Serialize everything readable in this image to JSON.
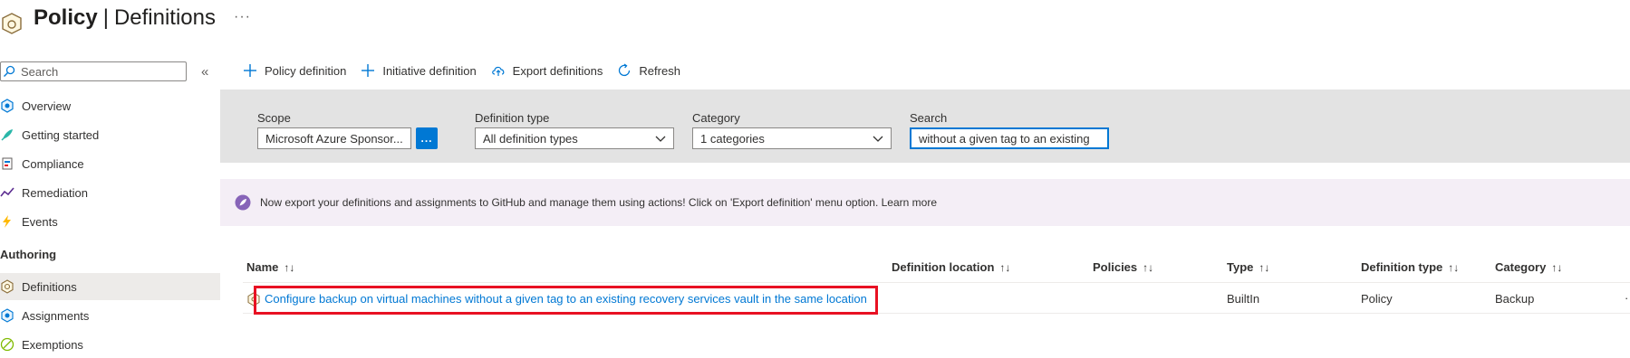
{
  "header": {
    "title_bold": "Policy",
    "title_sep": "|",
    "title_rest": "Definitions",
    "more": "···",
    "icon": "policy-icon"
  },
  "sidebar": {
    "search_placeholder": "Search",
    "collapse": "«",
    "items": [
      {
        "label": "Overview",
        "icon": "overview-icon"
      },
      {
        "label": "Getting started",
        "icon": "rocket-icon"
      },
      {
        "label": "Compliance",
        "icon": "compliance-icon"
      },
      {
        "label": "Remediation",
        "icon": "remediation-icon"
      },
      {
        "label": "Events",
        "icon": "lightning-icon"
      }
    ],
    "section": "Authoring",
    "authoring_items": [
      {
        "label": "Definitions",
        "icon": "definitions-icon",
        "active": true
      },
      {
        "label": "Assignments",
        "icon": "assignments-icon"
      },
      {
        "label": "Exemptions",
        "icon": "exemptions-icon"
      }
    ]
  },
  "toolbar": {
    "policy_definition": "Policy definition",
    "initiative_definition": "Initiative definition",
    "export_definitions": "Export definitions",
    "refresh": "Refresh"
  },
  "filters": {
    "scope_label": "Scope",
    "scope_value": "Microsoft Azure Sponsor...",
    "scope_button": "...",
    "definition_type_label": "Definition type",
    "definition_type_value": "All definition types",
    "category_label": "Category",
    "category_value": "1 categories",
    "search_label": "Search",
    "search_value": "without a given tag to an existing"
  },
  "banner": {
    "text": "Now export your definitions and assignments to GitHub and manage them using actions! Click on 'Export definition' menu option. Learn more"
  },
  "table": {
    "columns": [
      "Name",
      "Definition location",
      "Policies",
      "Type",
      "Definition type",
      "Category"
    ],
    "sort_glyph": "↑↓",
    "rows": [
      {
        "name": "Configure backup on virtual machines without a given tag to an existing recovery services vault in the same location",
        "definition_location": "",
        "policies": "",
        "type": "BuiltIn",
        "definition_type": "Policy",
        "category": "Backup"
      }
    ],
    "row_more": "·"
  },
  "colors": {
    "accent": "#0078d4",
    "highlight": "#e81123",
    "filter_bg": "#e3e3e3",
    "banner_bg": "#f4eef6"
  }
}
